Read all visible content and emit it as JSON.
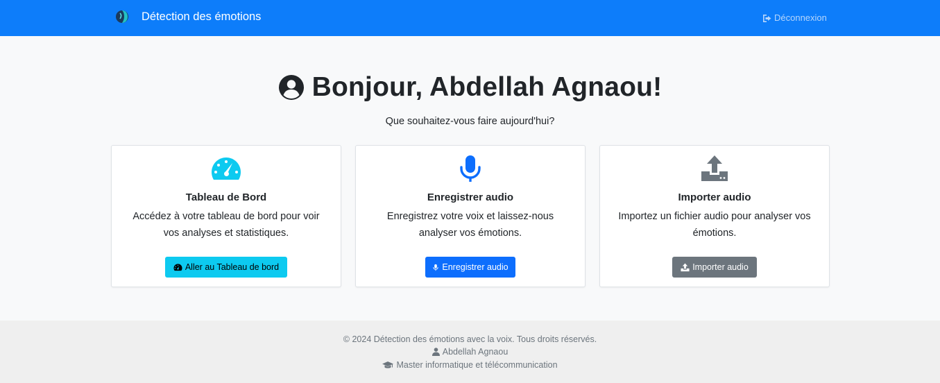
{
  "navbar": {
    "brand_text": "Détection des émotions",
    "logout_label": "Déconnexion",
    "logo_icon": "face-profile-logo",
    "logout_icon": "sign-out-icon",
    "color": "#0d7dfa"
  },
  "hero": {
    "greeting": "Bonjour, Abdellah Agnaou!",
    "subtitle": "Que souhaitez-vous faire aujourd'hui?",
    "icon": "user-circle-icon"
  },
  "cards": [
    {
      "icon": "dashboard-gauge-icon",
      "icon_color": "#0dcaf0",
      "title": "Tableau de Bord",
      "text": "Accédez à votre tableau de bord pour voir vos analyses et statistiques.",
      "button_label": "Aller au Tableau de bord",
      "button_color": "#0dcaf0"
    },
    {
      "icon": "microphone-icon",
      "icon_color": "#0d6efd",
      "title": "Enregistrer audio",
      "text": "Enregistrez votre voix et laissez-nous analyser vos émotions.",
      "button_label": "Enregistrer audio",
      "button_color": "#0d6efd"
    },
    {
      "icon": "upload-icon",
      "icon_color": "#6c757d",
      "title": "Importer audio",
      "text": "Importez un fichier audio pour analyser vos émotions.",
      "button_label": "Importer audio",
      "button_color": "#6c757d"
    }
  ],
  "footer": {
    "copyright": "© 2024 Détection des émotions avec la voix. Tous droits réservés.",
    "author": "Abdellah Agnaou",
    "program": "Master informatique et télécommunication",
    "author_icon": "user-icon",
    "program_icon": "graduation-cap-icon"
  }
}
